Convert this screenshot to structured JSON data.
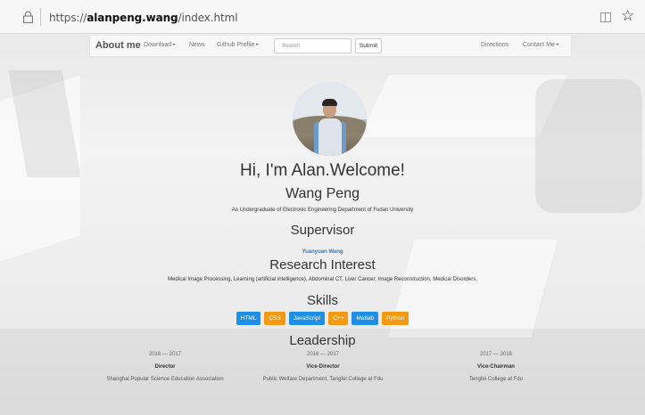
{
  "browser": {
    "url_prefix": "https://",
    "url_domain": "alanpeng.wang",
    "url_path": "/index.html"
  },
  "navbar": {
    "brand": "About me",
    "items": [
      "Download",
      "News",
      "Github Profile"
    ],
    "search_placeholder": "Search",
    "submit_label": "Submit",
    "right_items": [
      "Directions",
      "Contact Me"
    ]
  },
  "hero": {
    "welcome": "Hi, I'm Alan.Welcome!",
    "name": "Wang Peng",
    "affiliation": "An Undergraduate of Electronic Engineering Department of Fudan University"
  },
  "supervisor": {
    "heading": "Supervisor",
    "name": "Yuanyuan Wang"
  },
  "research": {
    "heading": "Research Interest",
    "text": "Medical Image Processing, Learning (artificial intelligence), Abdominal CT, Liver Cancer, Image Reconstruction, Medical Disorders,"
  },
  "skills": {
    "heading": "Skills",
    "items": [
      {
        "label": "HTML",
        "color": "#1e8fe6"
      },
      {
        "label": "CSS",
        "color": "#f39a12"
      },
      {
        "label": "JavaScript",
        "color": "#1e8fe6"
      },
      {
        "label": "C++",
        "color": "#f39a12"
      },
      {
        "label": "Matlab",
        "color": "#1e8fe6"
      },
      {
        "label": "Python",
        "color": "#f39a12"
      }
    ]
  },
  "leadership": {
    "heading": "Leadership",
    "entries": [
      {
        "period": "2016 — 2017",
        "role": "Director",
        "org": "Shanghai Popular Science Education Association"
      },
      {
        "period": "2016 — 2017",
        "role": "Vice-Director",
        "org": "Public Welfare Department, Tangfei College at Fdu"
      },
      {
        "period": "2017 — 2018",
        "role": "Vice-Chairman",
        "org": "Tengfei College at Fdu"
      }
    ]
  }
}
